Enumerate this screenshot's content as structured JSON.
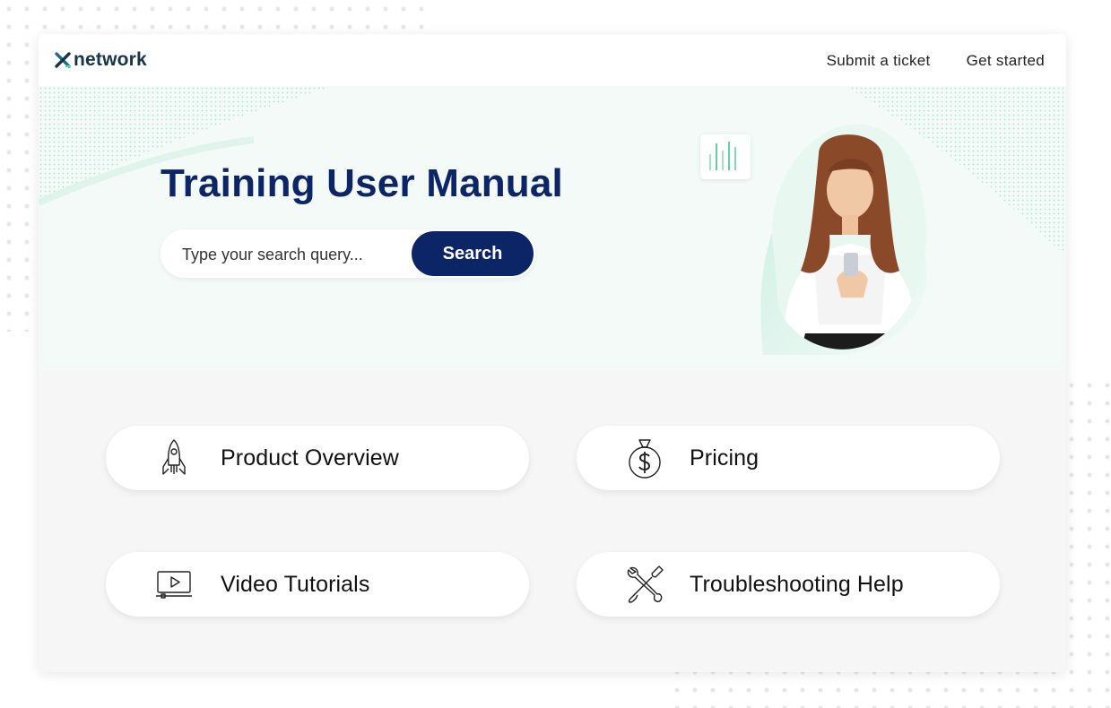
{
  "header": {
    "logo_text": "network",
    "nav": [
      {
        "label": "Submit a ticket"
      },
      {
        "label": "Get started"
      }
    ]
  },
  "hero": {
    "title": "Training User Manual",
    "search": {
      "placeholder": "Type your search query...",
      "value": "",
      "button_label": "Search"
    }
  },
  "tiles": [
    {
      "label": "Product Overview",
      "icon": "rocket-icon"
    },
    {
      "label": "Pricing",
      "icon": "money-bag-icon"
    },
    {
      "label": "Video Tutorials",
      "icon": "video-player-icon"
    },
    {
      "label": "Troubleshooting Help",
      "icon": "wrench-screwdriver-icon"
    }
  ],
  "colors": {
    "brand_navy": "#0c2567",
    "accent_mint": "#5fd3a6",
    "logo_teal": "#1c6b8a",
    "hero_background": "#f3faf8",
    "page_background": "#f6f6f6"
  }
}
